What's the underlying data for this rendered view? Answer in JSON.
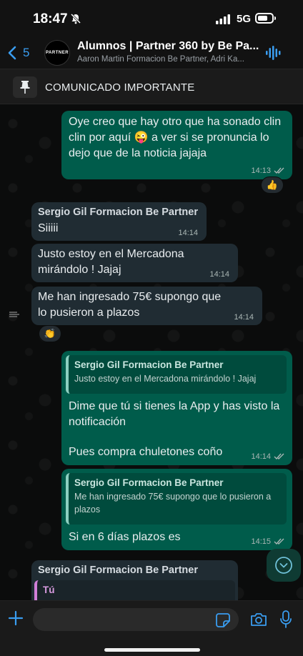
{
  "status": {
    "time": "18:47",
    "network": "5G"
  },
  "header": {
    "back_count": "5",
    "avatar_text": "PARTNER",
    "title": "Alumnos | Partner 360 by Be Pa...",
    "subtitle": "Aaron Martin Formacion Be Partner, Adri Ka..."
  },
  "pinned": {
    "text": "COMUNICADO IMPORTANTE"
  },
  "messages": [
    {
      "text": "Oye creo que hay otro que ha sonado clin clin por aquí 😜 a ver si se pronuncia lo dejo que de la noticia jajaja",
      "time": "14:13",
      "reaction": "👍"
    },
    {
      "sender": "Sergio Gil Formacion Be Partner",
      "text": "Siiiii",
      "time": "14:14"
    },
    {
      "text": "Justo estoy en el Mercadona mirándolo ! Jajaj",
      "time": "14:14"
    },
    {
      "text": "Me han ingresado 75€ supongo que lo pusieron a plazos",
      "time": "14:14",
      "reaction": "👏"
    },
    {
      "quote_name": "Sergio Gil Formacion Be Partner",
      "quote_text": "Justo estoy en el Mercadona mirándolo ! Jajaj",
      "text1": "Dime que tú si tienes la App y has visto la notificación",
      "text2": "Pues compra chuletones coño",
      "time": "14:14"
    },
    {
      "quote_name": "Sergio Gil Formacion Be Partner",
      "quote_text": "Me han ingresado 75€ supongo que lo pusieron a plazos",
      "text": "Si en 6 días plazos es",
      "time": "14:15"
    },
    {
      "sender": "Sergio Gil Formacion Be Partner",
      "quote_name": "Tú"
    }
  ],
  "icons": {
    "back": "chevron-left-icon",
    "pin": "pin-icon",
    "scroll": "chevron-down-icon",
    "plus": "plus-icon",
    "sticker": "sticker-icon",
    "camera": "camera-icon",
    "mic": "mic-icon"
  },
  "colors": {
    "outgoing": "#005c4b",
    "incoming": "#202c33",
    "accent": "#3a9df0"
  }
}
